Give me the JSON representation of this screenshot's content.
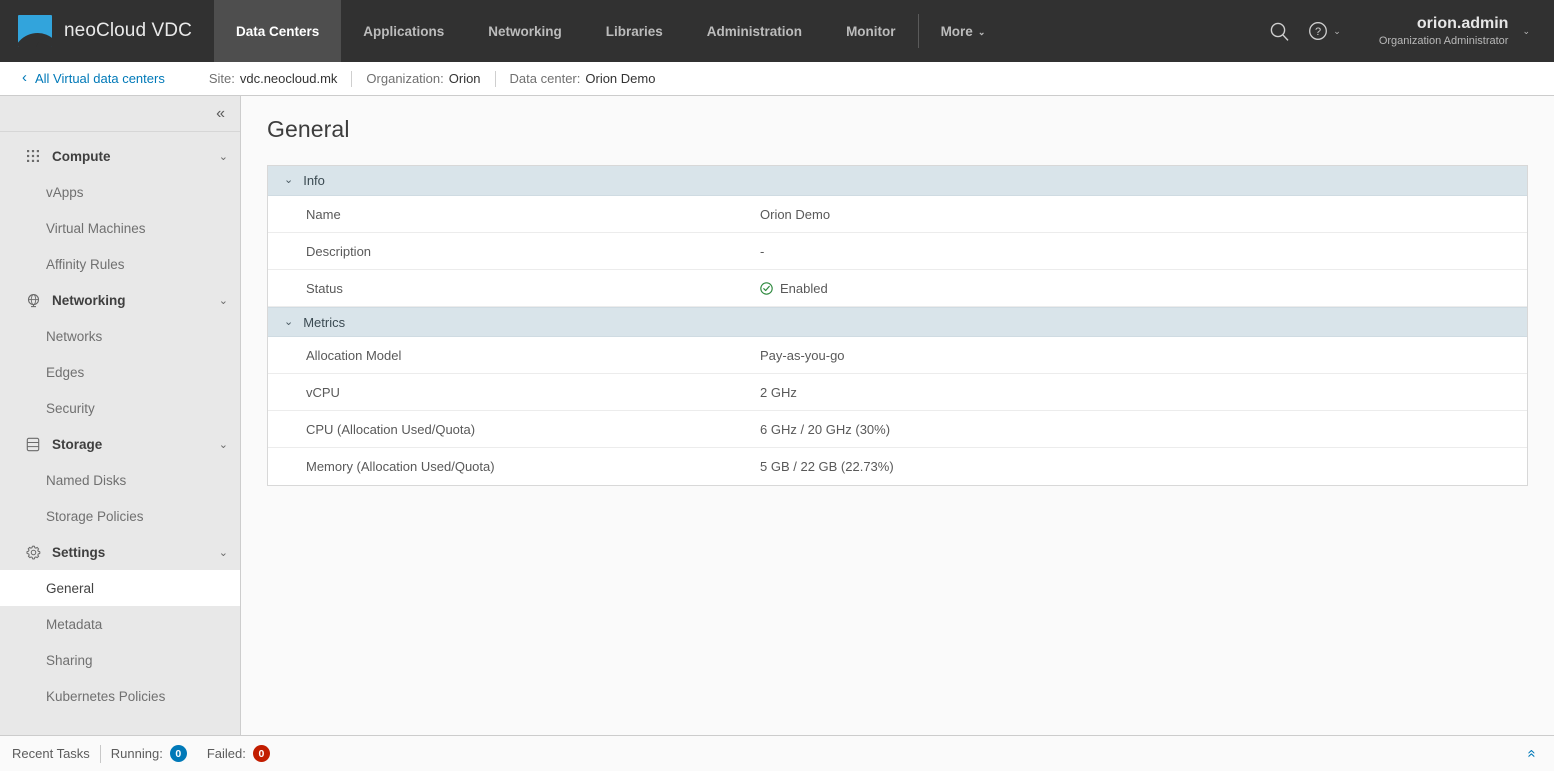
{
  "header": {
    "brand": "neoCloud VDC",
    "logo_color": "#32a4dc",
    "nav": [
      {
        "label": "Data Centers",
        "active": true
      },
      {
        "label": "Applications",
        "active": false
      },
      {
        "label": "Networking",
        "active": false
      },
      {
        "label": "Libraries",
        "active": false
      },
      {
        "label": "Administration",
        "active": false
      },
      {
        "label": "Monitor",
        "active": false
      }
    ],
    "more_label": "More",
    "more_caret": "⌄",
    "search_icon": "search-icon",
    "help_icon": "help-circle-icon",
    "help_caret": "⌄",
    "user_name": "orion.admin",
    "user_role": "Organization Administrator",
    "user_caret": "⌄"
  },
  "breadcrumb": {
    "back_chevron": "‹",
    "back_label": "All Virtual data centers",
    "segments": [
      {
        "label": "Site:",
        "value": "vdc.neocloud.mk"
      },
      {
        "label": "Organization:",
        "value": "Orion"
      },
      {
        "label": "Data center:",
        "value": "Orion Demo"
      }
    ]
  },
  "sidebar": {
    "collapse_icon": "«",
    "groups": [
      {
        "label": "Compute",
        "icon": "grid-dots-icon",
        "caret": "⌄",
        "items": [
          {
            "label": "vApps",
            "selected": false
          },
          {
            "label": "Virtual Machines",
            "selected": false
          },
          {
            "label": "Affinity Rules",
            "selected": false
          }
        ]
      },
      {
        "label": "Networking",
        "icon": "globe-network-icon",
        "caret": "⌄",
        "items": [
          {
            "label": "Networks",
            "selected": false
          },
          {
            "label": "Edges",
            "selected": false
          },
          {
            "label": "Security",
            "selected": false
          }
        ]
      },
      {
        "label": "Storage",
        "icon": "database-icon",
        "caret": "⌄",
        "items": [
          {
            "label": "Named Disks",
            "selected": false
          },
          {
            "label": "Storage Policies",
            "selected": false
          }
        ]
      },
      {
        "label": "Settings",
        "icon": "gear-icon",
        "caret": "⌄",
        "items": [
          {
            "label": "General",
            "selected": true
          },
          {
            "label": "Metadata",
            "selected": false
          },
          {
            "label": "Sharing",
            "selected": false
          },
          {
            "label": "Kubernetes Policies",
            "selected": false
          }
        ]
      }
    ]
  },
  "main": {
    "page_title": "General",
    "sections": [
      {
        "title": "Info",
        "caret": "⌄",
        "rows": [
          {
            "label": "Name",
            "value": "Orion Demo",
            "icon": null
          },
          {
            "label": "Description",
            "value": "-",
            "icon": null
          },
          {
            "label": "Status",
            "value": "Enabled",
            "icon": "check-circle-icon"
          }
        ]
      },
      {
        "title": "Metrics",
        "caret": "⌄",
        "rows": [
          {
            "label": "Allocation Model",
            "value": "Pay-as-you-go",
            "icon": null
          },
          {
            "label": "vCPU",
            "value": "2 GHz",
            "icon": null
          },
          {
            "label": "CPU (Allocation Used/Quota)",
            "value": "6 GHz / 20 GHz (30%)",
            "icon": null
          },
          {
            "label": "Memory (Allocation Used/Quota)",
            "value": "5 GB / 22 GB (22.73%)",
            "icon": null
          }
        ]
      }
    ],
    "status_color": "#2f8a3f"
  },
  "footer": {
    "recent_tasks_label": "Recent Tasks",
    "running_label": "Running:",
    "running_count": "0",
    "failed_label": "Failed:",
    "failed_count": "0",
    "expand_icon": "«",
    "running_color": "#0079b8",
    "failed_color": "#c21d00"
  }
}
